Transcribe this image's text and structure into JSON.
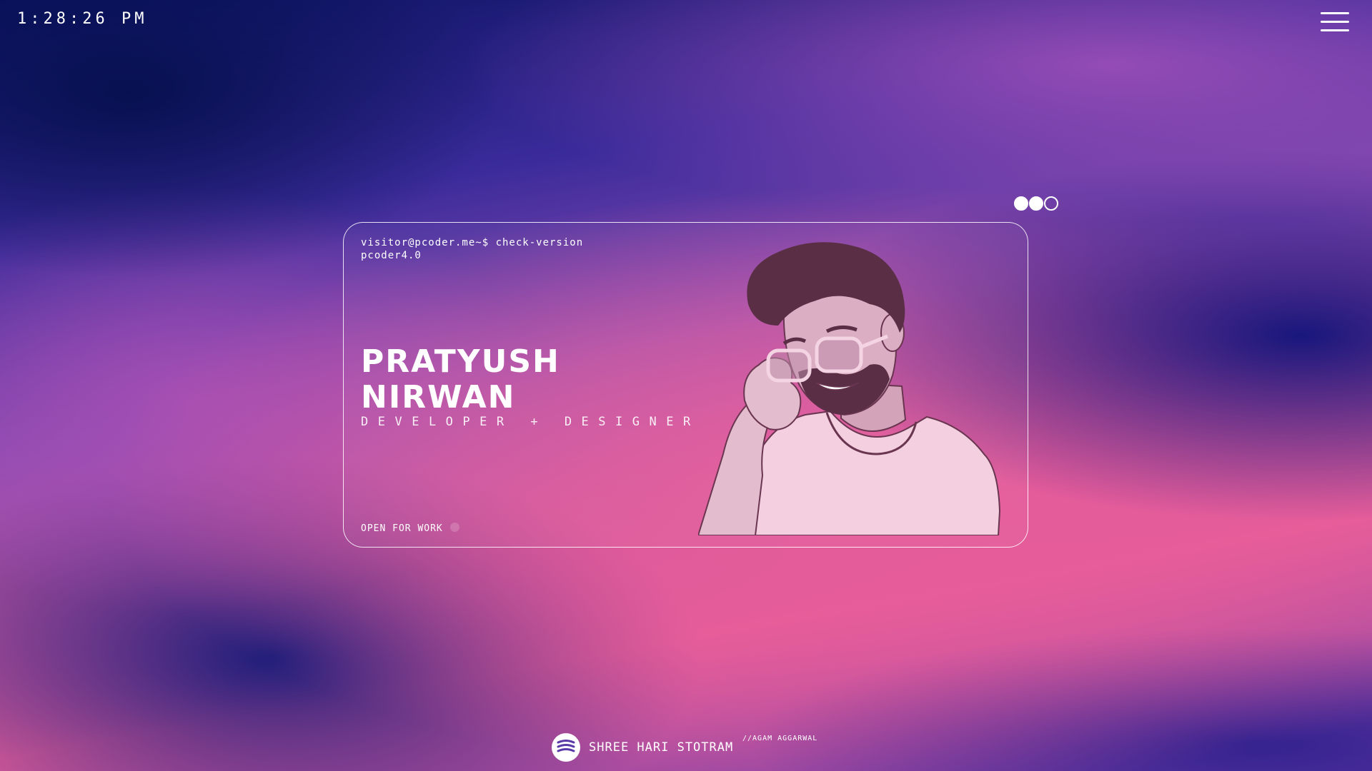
{
  "header": {
    "clock": "1:28:26 PM",
    "menu_icon": "hamburger-menu-icon"
  },
  "window_controls": {
    "dots": [
      {
        "state": "filled"
      },
      {
        "state": "filled"
      },
      {
        "state": "outline"
      }
    ]
  },
  "card": {
    "terminal_prompt": "visitor@pcoder.me~$ check-version",
    "terminal_output": "pcoder4.0",
    "name_first": "PRATYUSH",
    "name_last": "NIRWAN",
    "role": "DEVELOPER + DESIGNER",
    "status": "OPEN FOR WORK",
    "portrait_icon": "avatar-illustration"
  },
  "music": {
    "logo_icon": "music-logo-icon",
    "title": "SHREE HARI STOTRAM",
    "artist": "//AGAM AGGARWAL"
  },
  "colors": {
    "accent_pink": "#e85c9a",
    "deep_blue": "#0a1260",
    "violet": "#8b4bb2",
    "portrait_hair": "#5a2f45",
    "portrait_skin": "#dcaec4",
    "portrait_shirt": "#f4cfe0"
  }
}
